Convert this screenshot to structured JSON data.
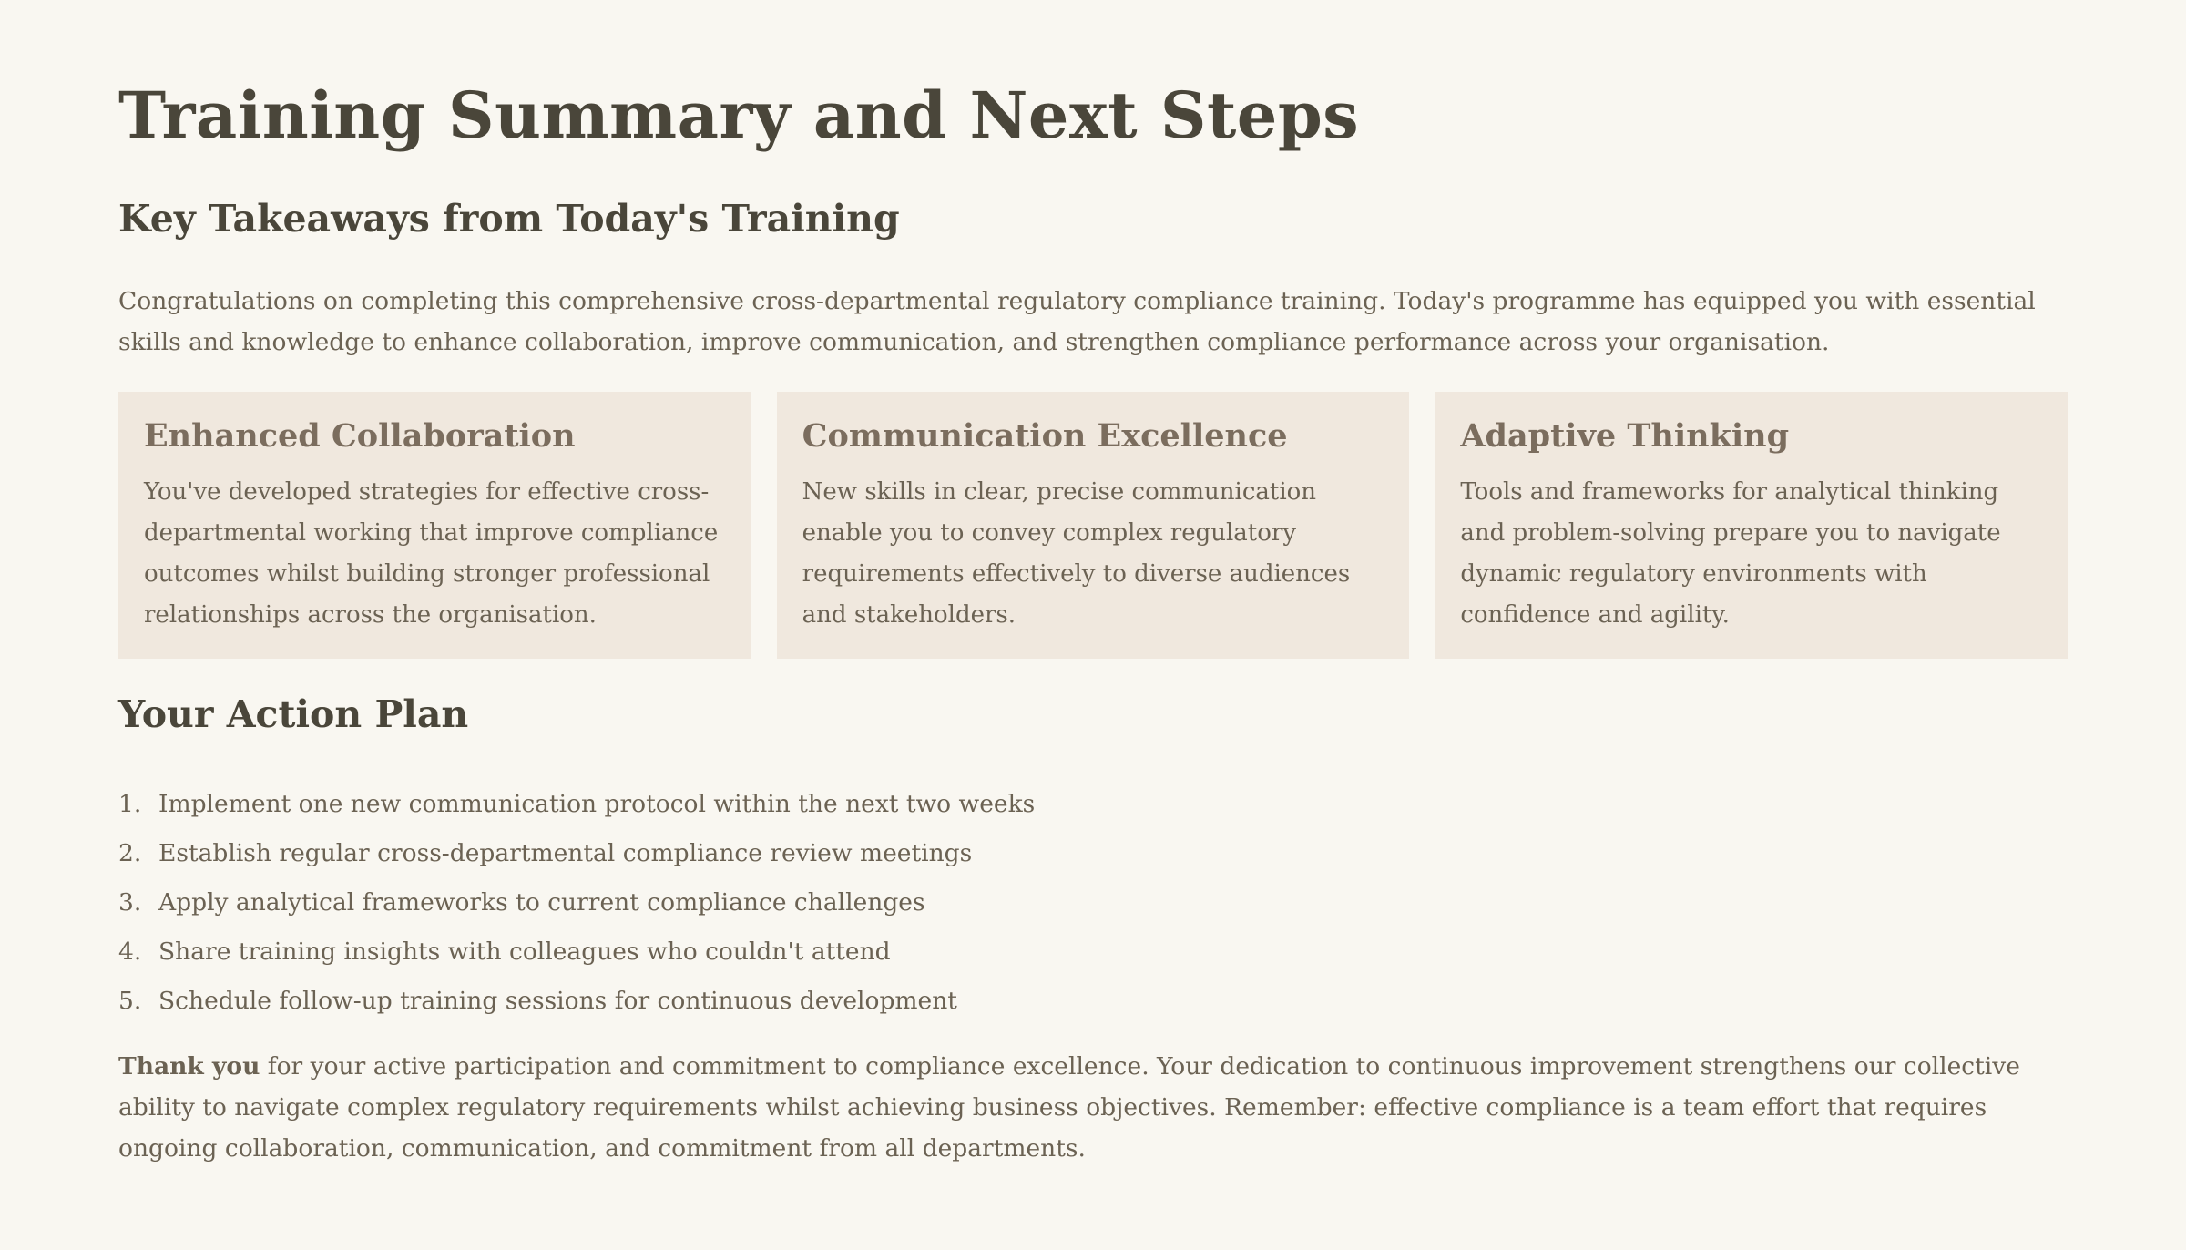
{
  "title": "Training Summary and Next Steps",
  "subtitle": "Key Takeaways from Today's Training",
  "intro": "Congratulations on completing this comprehensive cross-departmental regulatory compliance training. Today's programme has equipped you with essential skills and knowledge to enhance collaboration, improve communication, and strengthen compliance performance across your organisation.",
  "cards": [
    {
      "title": "Enhanced Collaboration",
      "text": "You've developed strategies for effective cross-departmental working that improve compliance outcomes whilst building stronger professional relationships across the organisation."
    },
    {
      "title": "Communication Excellence",
      "text": "New skills in clear, precise communication enable you to convey complex regulatory requirements effectively to diverse audiences and stakeholders."
    },
    {
      "title": "Adaptive Thinking",
      "text": "Tools and frameworks for analytical thinking and problem-solving prepare you to navigate dynamic regulatory environments with confidence and agility."
    }
  ],
  "action_plan": {
    "heading": "Your Action Plan",
    "items": [
      {
        "num": "1.",
        "text": "Implement one new communication protocol within the next two weeks"
      },
      {
        "num": "2.",
        "text": "Establish regular cross-departmental compliance review meetings"
      },
      {
        "num": "3.",
        "text": "Apply analytical frameworks to current compliance challenges"
      },
      {
        "num": "4.",
        "text": "Share training insights with colleagues who couldn't attend"
      },
      {
        "num": "5.",
        "text": "Schedule follow-up training sessions for continuous development"
      }
    ]
  },
  "closing": {
    "bold": "Thank you",
    "text": " for your active participation and commitment to compliance excellence. Your dedication to continuous improvement strengthens our collective ability to navigate complex regulatory requirements whilst achieving business objectives. Remember: effective compliance is a team effort that requires ongoing collaboration, communication, and commitment from all departments."
  }
}
